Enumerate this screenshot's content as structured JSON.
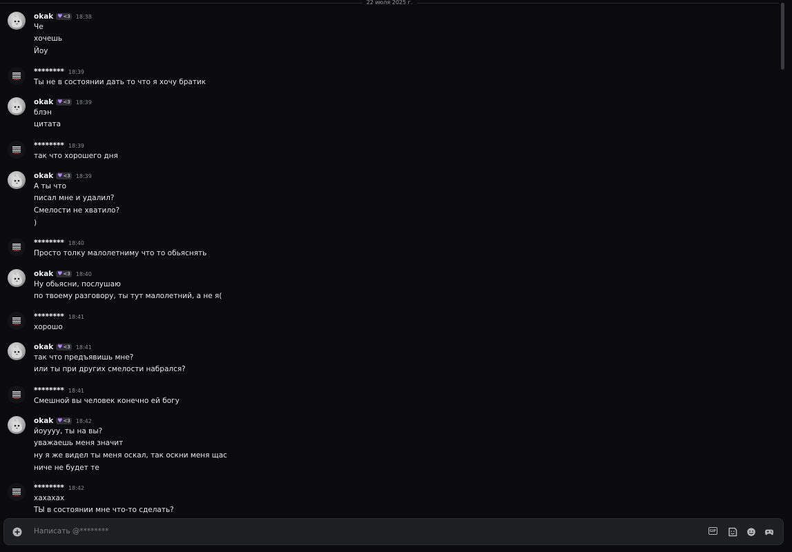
{
  "date_divider": "22 июля 2025 г.",
  "messages": [
    {
      "author": "okak",
      "kind": "okak",
      "badge": "<3",
      "time": "18:38",
      "lines": [
        "Че",
        "хочешь",
        "Йоу"
      ]
    },
    {
      "author": "********",
      "kind": "stars",
      "badge": "",
      "time": "18:39",
      "lines": [
        "Ты не в состоянии дать то что я хочу братик"
      ]
    },
    {
      "author": "okak",
      "kind": "okak",
      "badge": "<3",
      "time": "18:39",
      "lines": [
        "блэн",
        "цитата"
      ]
    },
    {
      "author": "********",
      "kind": "stars",
      "badge": "",
      "time": "18:39",
      "lines": [
        "так что хорошего дня"
      ]
    },
    {
      "author": "okak",
      "kind": "okak",
      "badge": "<3",
      "time": "18:39",
      "lines": [
        "А ты что",
        "писал мне и удалил?",
        "Смелости не хватило?",
        ")"
      ]
    },
    {
      "author": "********",
      "kind": "stars",
      "badge": "",
      "time": "18:40",
      "lines": [
        "Просто толку малолетниму что то обьяснять"
      ]
    },
    {
      "author": "okak",
      "kind": "okak",
      "badge": "<3",
      "time": "18:40",
      "lines": [
        "Ну обьясни, послушаю",
        "по твоему разговору, ты тут малолетний, а не я("
      ]
    },
    {
      "author": "********",
      "kind": "stars",
      "badge": "",
      "time": "18:41",
      "lines": [
        "хорошо"
      ]
    },
    {
      "author": "okak",
      "kind": "okak",
      "badge": "<3",
      "time": "18:41",
      "lines": [
        "так что предъявишь мне?",
        "или ты при других смелости набрался?"
      ]
    },
    {
      "author": "********",
      "kind": "stars",
      "badge": "",
      "time": "18:41",
      "lines": [
        "Смешной вы человек конечно ей богу"
      ]
    },
    {
      "author": "okak",
      "kind": "okak",
      "badge": "<3",
      "time": "18:42",
      "lines": [
        "йоуууу, ты на вы?",
        "уважаешь меня значит",
        "ну я же видел ты меня оскал, так оскни меня щас",
        "ниче не будет те"
      ]
    },
    {
      "author": "********",
      "kind": "stars",
      "badge": "",
      "time": "18:42",
      "lines": [
        "хахахах",
        "ТЫ в состоянии мне что-то сделать?"
      ]
    }
  ],
  "composer": {
    "placeholder": "Написать @********",
    "gif_label": "GIF"
  },
  "icons": {
    "add": "plus-circle-icon",
    "gif": "gif-icon",
    "sticker": "sticker-icon",
    "emoji": "emoji-icon",
    "apps": "gamepad-icon"
  },
  "colors": {
    "background": "#0b0b0d",
    "composer": "#1e1f22",
    "badge_heart": "#b58cff"
  }
}
